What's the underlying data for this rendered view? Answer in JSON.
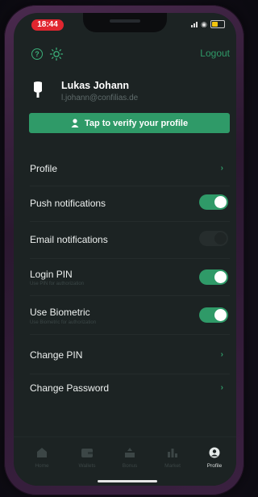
{
  "status_bar": {
    "time": "18:44"
  },
  "header": {
    "logout_label": "Logout"
  },
  "user": {
    "name": "Lukas Johann",
    "email": "l.johann@confilias.de"
  },
  "verify_button": {
    "label": "Tap to verify your profile"
  },
  "settings": [
    {
      "id": "profile",
      "title": "Profile",
      "type": "link"
    },
    {
      "id": "push",
      "title": "Push notifications",
      "type": "toggle",
      "on": true
    },
    {
      "id": "email",
      "title": "Email notifications",
      "type": "toggle",
      "on": false
    },
    {
      "id": "pin",
      "title": "Login PIN",
      "subtitle": "Use PIN for authorization",
      "type": "toggle",
      "on": true
    },
    {
      "id": "biometric",
      "title": "Use Biometric",
      "subtitle": "Use Biometric for authorization",
      "type": "toggle",
      "on": true
    },
    {
      "id": "change_pin",
      "title": "Change PIN",
      "type": "link"
    },
    {
      "id": "change_password",
      "title": "Change Password",
      "type": "link"
    }
  ],
  "tabs": [
    {
      "label": "Home",
      "icon": "home-icon",
      "active": false
    },
    {
      "label": "Wallets",
      "icon": "wallet-icon",
      "active": false
    },
    {
      "label": "Bonus",
      "icon": "bonus-icon",
      "active": false
    },
    {
      "label": "Market",
      "icon": "market-icon",
      "active": false
    },
    {
      "label": "Profile",
      "icon": "profile-icon",
      "active": true
    }
  ],
  "colors": {
    "accent": "#2f9a68",
    "background": "#1c2323",
    "status_pill": "#e0262f"
  }
}
